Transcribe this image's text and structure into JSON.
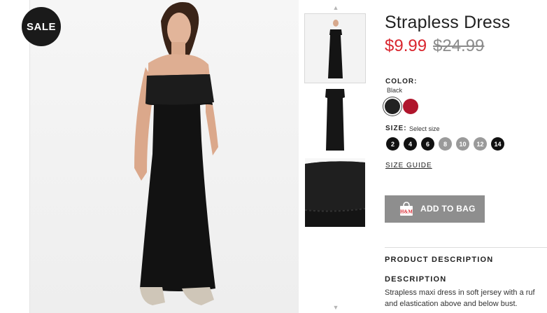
{
  "badge": {
    "sale": "SALE"
  },
  "product": {
    "title": "Strapless Dress",
    "price_current": "$9.99",
    "price_original": "$24.99",
    "color": {
      "label": "COLOR:",
      "selected": "Black",
      "swatches": [
        "#222222",
        "#b0152c"
      ]
    },
    "size": {
      "label": "SIZE:",
      "select_prompt": "Select size",
      "options": [
        {
          "value": "2",
          "available": true
        },
        {
          "value": "4",
          "available": true
        },
        {
          "value": "6",
          "available": true
        },
        {
          "value": "8",
          "available": false
        },
        {
          "value": "10",
          "available": false
        },
        {
          "value": "12",
          "available": false
        },
        {
          "value": "14",
          "available": true
        }
      ]
    },
    "size_guide": "SIZE GUIDE",
    "add_to_bag": "ADD TO BAG",
    "bag_logo": "H&M"
  },
  "description": {
    "section_heading": "PRODUCT DESCRIPTION",
    "heading": "DESCRIPTION",
    "lines": [
      "Strapless maxi dress in soft jersey with a ruf",
      "and elastication above and below bust."
    ]
  },
  "colors": {
    "sale_red": "#d9262f",
    "button_gray": "#8e8e8e"
  },
  "icons": [
    "chevron-up-icon",
    "chevron-down-icon",
    "shopping-bag-icon"
  ]
}
